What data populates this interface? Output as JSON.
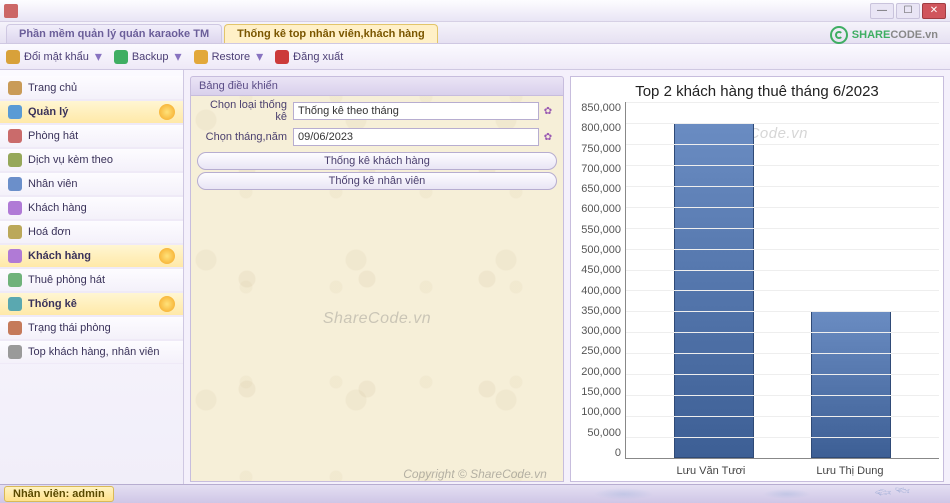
{
  "window": {
    "title": "",
    "min": "—",
    "max": "☐",
    "close": "✕"
  },
  "tabs": [
    {
      "label": "Phần mềm quản lý quán karaoke TM",
      "active": false
    },
    {
      "label": "Thống kê top nhân viên,khách hàng",
      "active": true
    }
  ],
  "toolbar": {
    "change_pw": "Đổi mật khẩu",
    "backup": "Backup",
    "restore": "Restore",
    "logout": "Đăng xuất"
  },
  "sidebar": {
    "items": [
      {
        "label": "Trang chủ",
        "kind": "item",
        "icon": "ic-home"
      },
      {
        "label": "Quản lý",
        "kind": "header",
        "icon": "ic-manage",
        "sun": true,
        "sel": true
      },
      {
        "label": "Phòng hát",
        "kind": "item",
        "icon": "ic-room"
      },
      {
        "label": "Dịch vụ kèm theo",
        "kind": "item",
        "icon": "ic-service"
      },
      {
        "label": "Nhân viên",
        "kind": "item",
        "icon": "ic-staff"
      },
      {
        "label": "Khách hàng",
        "kind": "item",
        "icon": "ic-cust"
      },
      {
        "label": "Hoá đơn",
        "kind": "item",
        "icon": "ic-inv"
      },
      {
        "label": "Khách hàng",
        "kind": "header",
        "icon": "ic-cust",
        "sun": true,
        "sel": true
      },
      {
        "label": "Thuê phòng hát",
        "kind": "item",
        "icon": "ic-rent"
      },
      {
        "label": "Thống kê",
        "kind": "header",
        "icon": "ic-stats",
        "sun": true,
        "sel": true
      },
      {
        "label": "Trạng thái phòng",
        "kind": "item",
        "icon": "ic-status"
      },
      {
        "label": "Top khách hàng, nhân viên",
        "kind": "item",
        "icon": "ic-top"
      }
    ]
  },
  "panel": {
    "title": "Bảng điều khiển",
    "row1_label": "Chọn loại thống kê",
    "row1_value": "Thống kê theo tháng",
    "row2_label": "Chọn tháng,năm",
    "row2_value": "09/06/2023",
    "btn_customer": "Thống kê khách hàng",
    "btn_staff": "Thống kê nhân viên",
    "watermark": "ShareCode.vn"
  },
  "chart_data": {
    "type": "bar",
    "title": "Top 2 khách hàng thuê tháng 6/2023",
    "categories": [
      "Lưu Văn Tươi",
      "Lưu Thị Dung"
    ],
    "values": [
      800000,
      350000
    ],
    "ylim": [
      0,
      850000
    ],
    "y_ticks": [
      "850,000",
      "800,000",
      "750,000",
      "700,000",
      "650,000",
      "600,000",
      "550,000",
      "500,000",
      "450,000",
      "400,000",
      "350,000",
      "300,000",
      "250,000",
      "200,000",
      "150,000",
      "100,000",
      "50,000",
      "0"
    ],
    "watermark": "ShareCode.vn"
  },
  "logo": {
    "a": "SHARE",
    "b": "CODE",
    "c": ".vn"
  },
  "bottom_watermark": "Copyright © ShareCode.vn",
  "statusbar": {
    "user": "Nhân viên: admin"
  }
}
